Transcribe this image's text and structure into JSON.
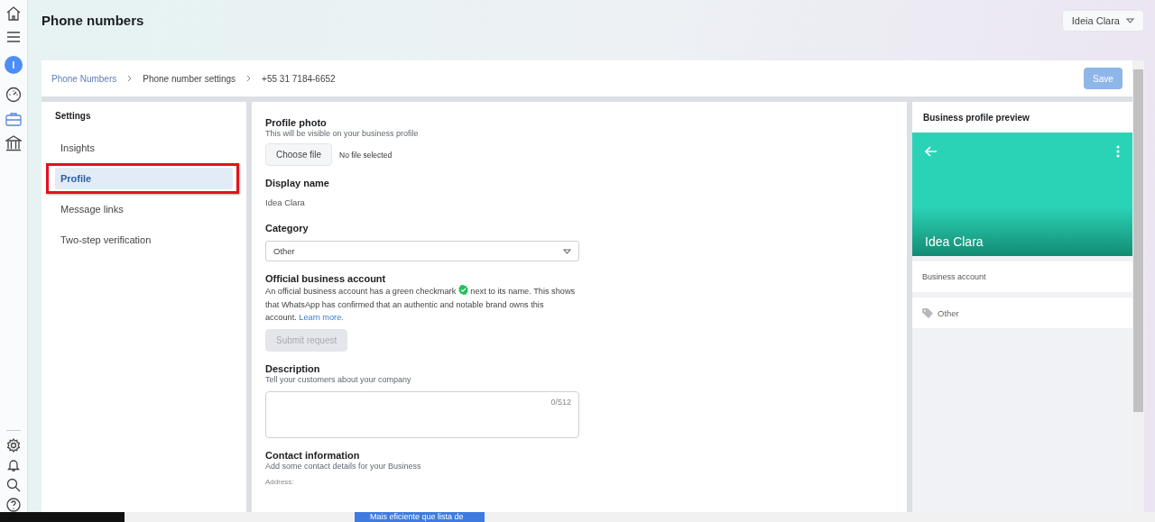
{
  "rail": {
    "top_items": [
      {
        "kind": "home",
        "selected": false
      },
      {
        "kind": "menu",
        "selected": false
      },
      {
        "kind": "avatar",
        "label": "I",
        "selected": false
      },
      {
        "kind": "gauge",
        "selected": false
      },
      {
        "kind": "briefcase",
        "selected": true
      },
      {
        "kind": "bank",
        "selected": false
      }
    ],
    "bottom_items": [
      {
        "kind": "settings"
      },
      {
        "kind": "bell"
      },
      {
        "kind": "search"
      },
      {
        "kind": "help"
      }
    ]
  },
  "header": {
    "title": "Phone numbers",
    "account": "Ideia Clara"
  },
  "breadcrumbs": [
    {
      "label": "Phone Numbers",
      "link": true
    },
    {
      "label": "Phone number settings",
      "link": false
    },
    {
      "label": "+55 31 7184-6652",
      "link": false
    }
  ],
  "save_button": {
    "label": "Save",
    "disabled": true
  },
  "settings": {
    "title": "Settings",
    "items": [
      {
        "label": "Insights",
        "selected": false,
        "highlighted": false
      },
      {
        "label": "Profile",
        "selected": true,
        "highlighted": true
      },
      {
        "label": "Message links",
        "selected": false,
        "highlighted": false
      },
      {
        "label": "Two-step verification",
        "selected": false,
        "highlighted": false
      }
    ]
  },
  "form": {
    "profile_photo": {
      "title": "Profile photo",
      "hint": "This will be visible on your business profile",
      "button": "Choose file",
      "status": "No file selected"
    },
    "display_name": {
      "title": "Display name",
      "value": "Idea Clara"
    },
    "category": {
      "title": "Category",
      "value": "Other"
    },
    "official_account": {
      "title": "Official business account",
      "text_before": "An official business account has a green checkmark",
      "text_after": "next to its name. This shows that WhatsApp has confirmed that an authentic and notable brand owns this account.",
      "link": "Learn more.",
      "button": "Submit request",
      "button_disabled": true
    },
    "description": {
      "title": "Description",
      "hint": "Tell your customers about your company",
      "counter": "0/512"
    },
    "contact": {
      "title": "Contact information",
      "hint": "Add some contact details for your Business",
      "field_label": "Address:"
    }
  },
  "preview": {
    "title": "Business profile preview",
    "name": "Idea Clara",
    "account_type": "Business account",
    "category": "Other"
  },
  "taskbar": {
    "text": "Mais eficiente que lista de"
  }
}
